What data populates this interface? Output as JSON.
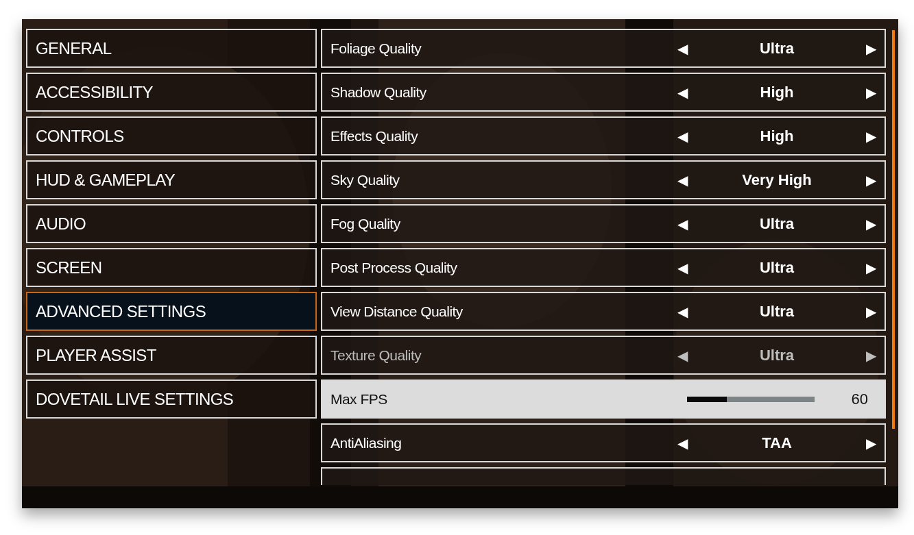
{
  "categories": [
    {
      "label": "GENERAL",
      "selected": false
    },
    {
      "label": "ACCESSIBILITY",
      "selected": false
    },
    {
      "label": "CONTROLS",
      "selected": false
    },
    {
      "label": "HUD & GAMEPLAY",
      "selected": false
    },
    {
      "label": "AUDIO",
      "selected": false
    },
    {
      "label": "SCREEN",
      "selected": false
    },
    {
      "label": "ADVANCED SETTINGS",
      "selected": true
    },
    {
      "label": "PLAYER ASSIST",
      "selected": false
    },
    {
      "label": "DOVETAIL LIVE SETTINGS",
      "selected": false
    }
  ],
  "settings": [
    {
      "kind": "selector",
      "label": "Foliage Quality",
      "value": "Ultra",
      "left": "◀",
      "right": "▶",
      "disabled": false,
      "selected": false
    },
    {
      "kind": "selector",
      "label": "Shadow Quality",
      "value": "High",
      "left": "◀",
      "right": "▶",
      "disabled": false,
      "selected": false
    },
    {
      "kind": "selector",
      "label": "Effects Quality",
      "value": "High",
      "left": "◀",
      "right": "▶",
      "disabled": false,
      "selected": false
    },
    {
      "kind": "selector",
      "label": "Sky Quality",
      "value": "Very High",
      "left": "◀",
      "right": "▶",
      "disabled": false,
      "selected": false
    },
    {
      "kind": "selector",
      "label": "Fog Quality",
      "value": "Ultra",
      "left": "◀",
      "right": "▶",
      "disabled": false,
      "selected": false
    },
    {
      "kind": "selector",
      "label": "Post Process Quality",
      "value": "Ultra",
      "left": "◀",
      "right": "▶",
      "disabled": false,
      "selected": false
    },
    {
      "kind": "selector",
      "label": "View Distance Quality",
      "value": "Ultra",
      "left": "◀",
      "right": "▶",
      "disabled": false,
      "selected": false
    },
    {
      "kind": "selector",
      "label": "Texture Quality",
      "value": "Ultra",
      "left": "◀",
      "right": "▶",
      "disabled": true,
      "selected": false
    },
    {
      "kind": "slider",
      "label": "Max FPS",
      "value": "60",
      "level": 0.31,
      "disabled": false,
      "selected": true
    },
    {
      "kind": "selector",
      "label": "AntiAliasing",
      "value": "TAA",
      "left": "◀",
      "right": "▶",
      "disabled": false,
      "selected": false
    }
  ]
}
